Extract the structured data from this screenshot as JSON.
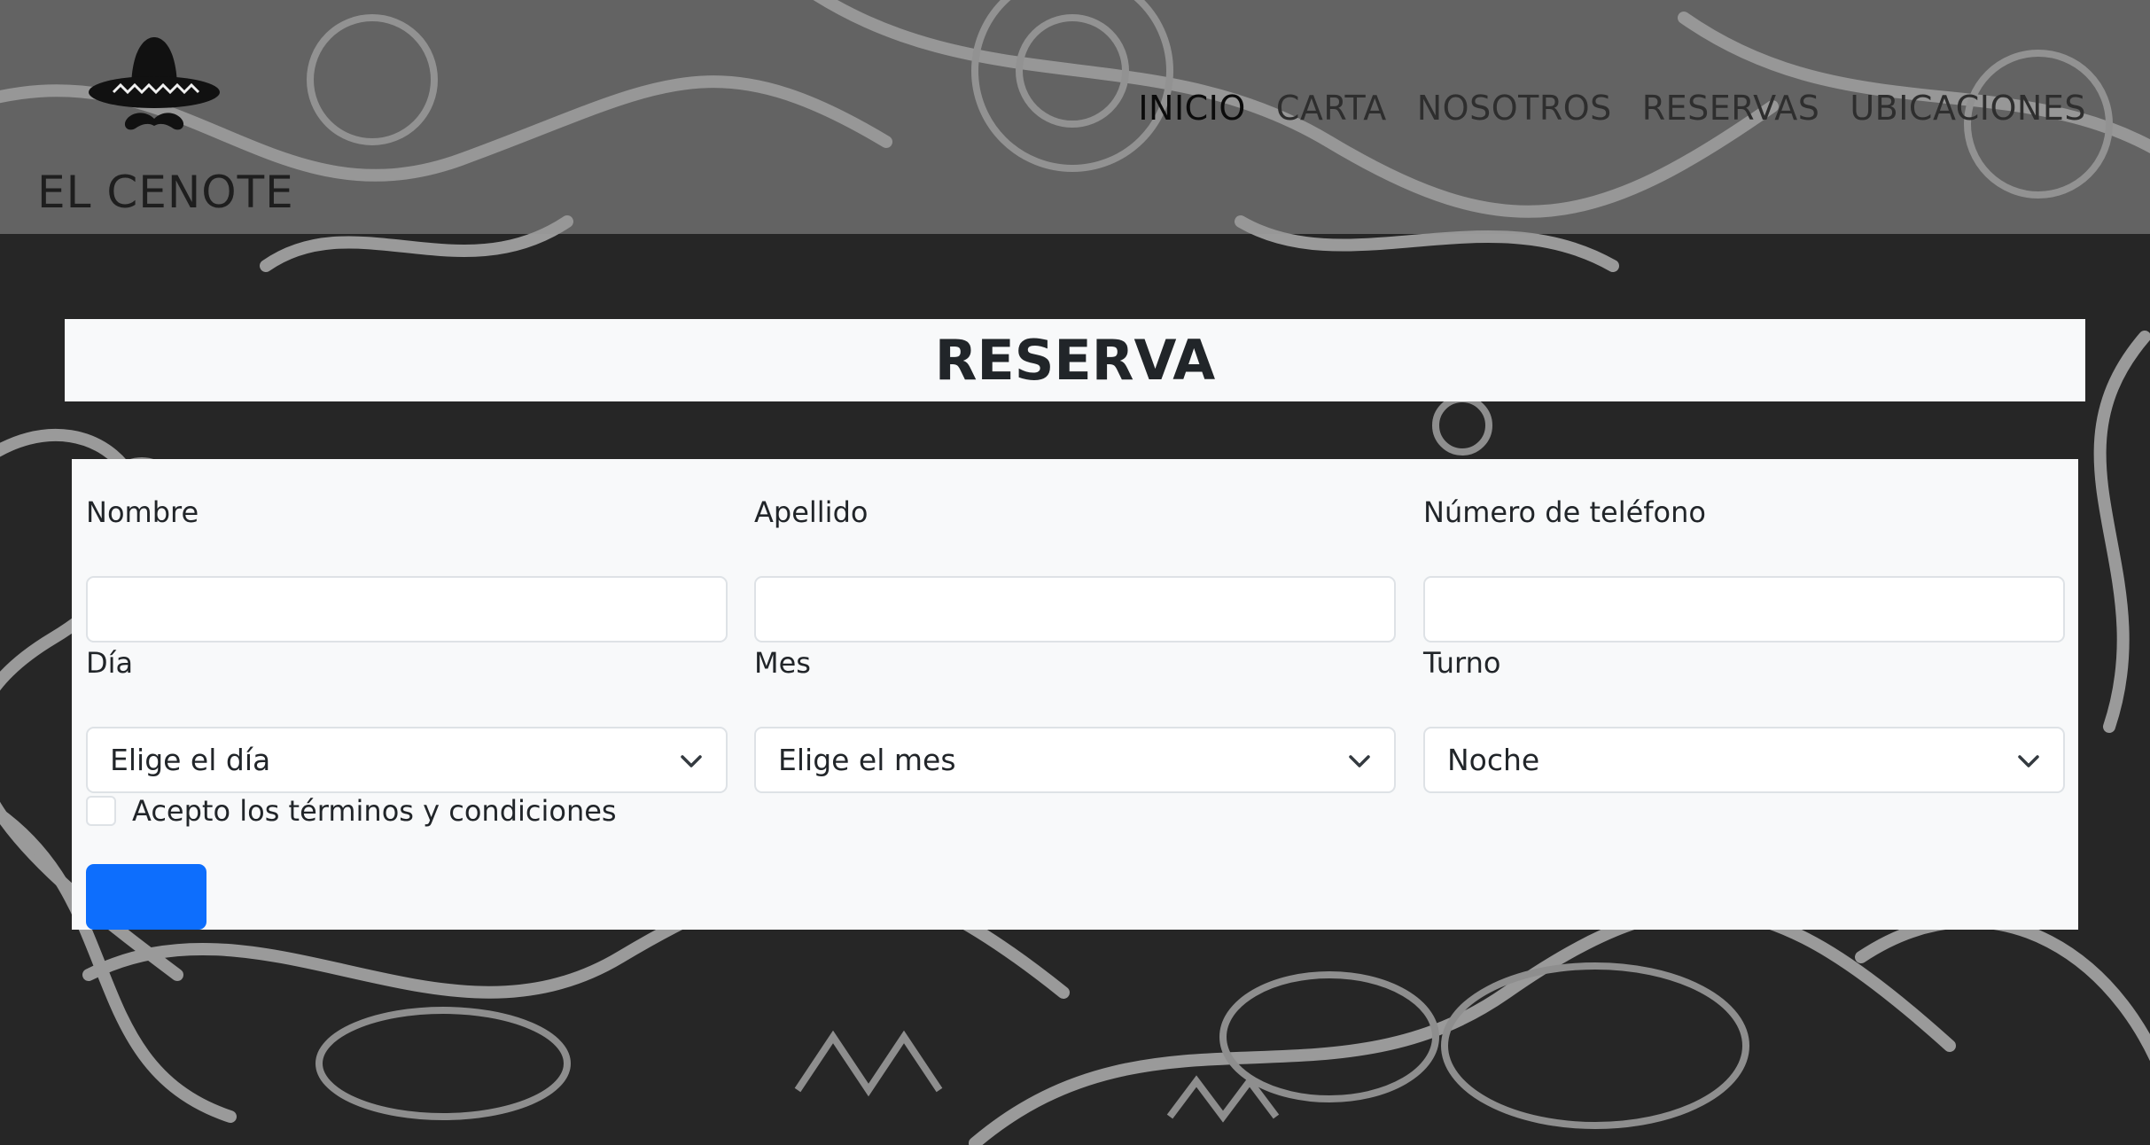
{
  "brand": {
    "name": "EL CENOTE",
    "logo_icon": "sombrero-mustache-icon"
  },
  "nav": {
    "items": [
      {
        "label": "INICIO",
        "active": true
      },
      {
        "label": "CARTA",
        "active": false
      },
      {
        "label": "NOSOTROS",
        "active": false
      },
      {
        "label": "RESERVAS",
        "active": false
      },
      {
        "label": "UBICACIONES",
        "active": false
      }
    ]
  },
  "page": {
    "title": "RESERVA"
  },
  "form": {
    "nombre": {
      "label": "Nombre",
      "value": ""
    },
    "apellido": {
      "label": "Apellido",
      "value": ""
    },
    "telefono": {
      "label": "Número de teléfono",
      "value": ""
    },
    "dia": {
      "label": "Día",
      "selected": "Elige el día"
    },
    "mes": {
      "label": "Mes",
      "selected": "Elige el mes"
    },
    "turno": {
      "label": "Turno",
      "selected": "Noche"
    },
    "terms": {
      "label": "Acepto los términos y condiciones",
      "checked": false
    },
    "submit_label": ""
  },
  "colors": {
    "primary": "#0d6efd",
    "card": "#f8f9fa",
    "header_overlay": "#969696"
  }
}
